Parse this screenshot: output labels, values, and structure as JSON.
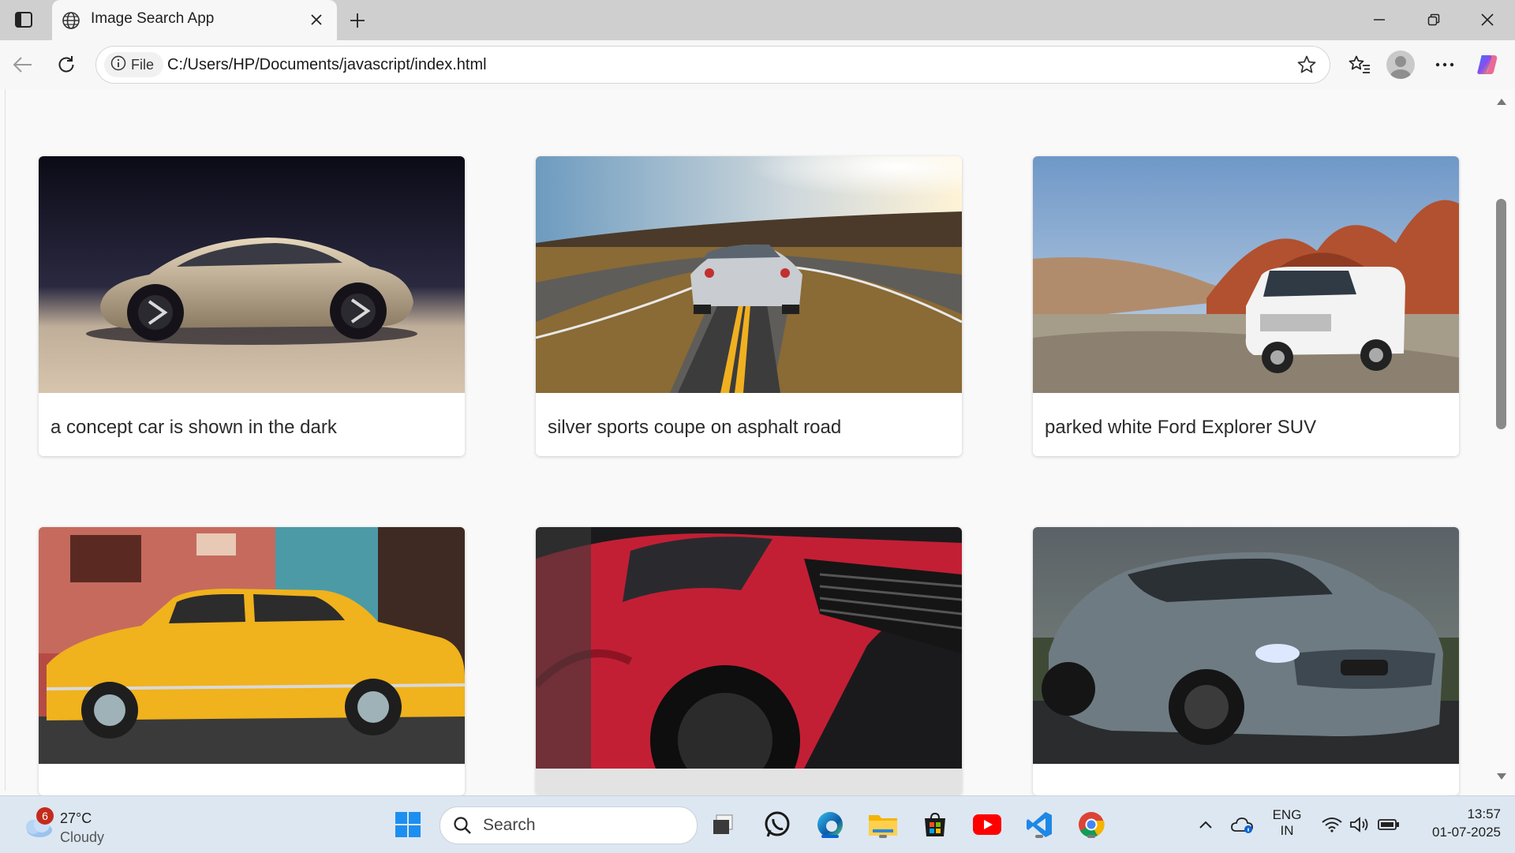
{
  "browser": {
    "tab_title": "Image Search App",
    "url_chip": "File",
    "url": "C:/Users/HP/Documents/javascript/index.html"
  },
  "cards": [
    {
      "caption": "a concept car is shown in the dark"
    },
    {
      "caption": "silver sports coupe on asphalt road"
    },
    {
      "caption": "parked white Ford Explorer SUV"
    },
    {
      "caption": ""
    },
    {
      "caption": ""
    },
    {
      "caption": ""
    }
  ],
  "taskbar": {
    "weather_badge": "6",
    "temperature": "27°C",
    "condition": "Cloudy",
    "search_placeholder": "Search",
    "lang_top": "ENG",
    "lang_bottom": "IN",
    "time": "13:57",
    "date": "01-07-2025"
  },
  "colors": {
    "accent": "#0a64d6",
    "tab_bar": "#cfcfcf",
    "taskbar": "#dde7f1"
  },
  "icons": {
    "taskbar_apps": [
      "windows-start-icon",
      "task-view-icon",
      "whatsapp-icon",
      "edge-icon",
      "file-explorer-icon",
      "microsoft-store-icon",
      "youtube-icon",
      "vscode-icon",
      "chrome-icon"
    ]
  }
}
